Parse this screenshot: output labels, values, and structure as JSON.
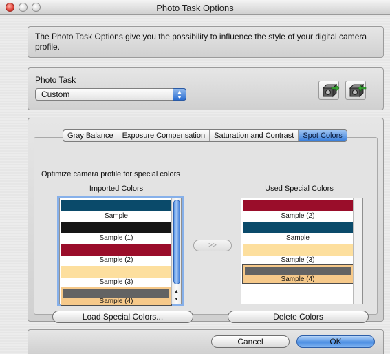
{
  "window": {
    "title": "Photo Task Options"
  },
  "intro": {
    "text": "The Photo Task Options give you the possibility to influence the style of your digital camera profile."
  },
  "photo_task": {
    "label": "Photo Task",
    "selected": "Custom",
    "buttons": [
      {
        "icon": "camera-export-icon"
      },
      {
        "icon": "camera-import-icon"
      }
    ]
  },
  "tabs": [
    {
      "label": "Gray Balance",
      "active": false
    },
    {
      "label": "Exposure Compensation",
      "active": false
    },
    {
      "label": "Saturation and Contrast",
      "active": false
    },
    {
      "label": "Spot Colors",
      "active": true
    }
  ],
  "spot": {
    "description": "Optimize camera profile for special colors",
    "imported_header": "Imported Colors",
    "used_header": "Used Special Colors",
    "imported": [
      {
        "label": "Sample",
        "color": "#0a4a6a",
        "selected": false
      },
      {
        "label": "Sample (1)",
        "color": "#151515",
        "selected": false
      },
      {
        "label": "Sample (2)",
        "color": "#9a0d2a",
        "selected": false
      },
      {
        "label": "Sample (3)",
        "color": "#fddf9e",
        "selected": false
      },
      {
        "label": "Sample (4)",
        "color": "#636363",
        "selected": true
      }
    ],
    "used": [
      {
        "label": "Sample (2)",
        "color": "#9a0d2a",
        "selected": false
      },
      {
        "label": "Sample",
        "color": "#0a4a6a",
        "selected": false
      },
      {
        "label": "Sample (3)",
        "color": "#fddf9e",
        "selected": false
      },
      {
        "label": "Sample (4)",
        "color": "#636363",
        "selected": true
      }
    ],
    "transfer_label": ">>",
    "load_label": "Load Special Colors...",
    "delete_label": "Delete Colors"
  },
  "footer": {
    "cancel_label": "Cancel",
    "ok_label": "OK"
  },
  "colors": {
    "accent": "#3b80dc",
    "selection": "#f6c98a"
  }
}
